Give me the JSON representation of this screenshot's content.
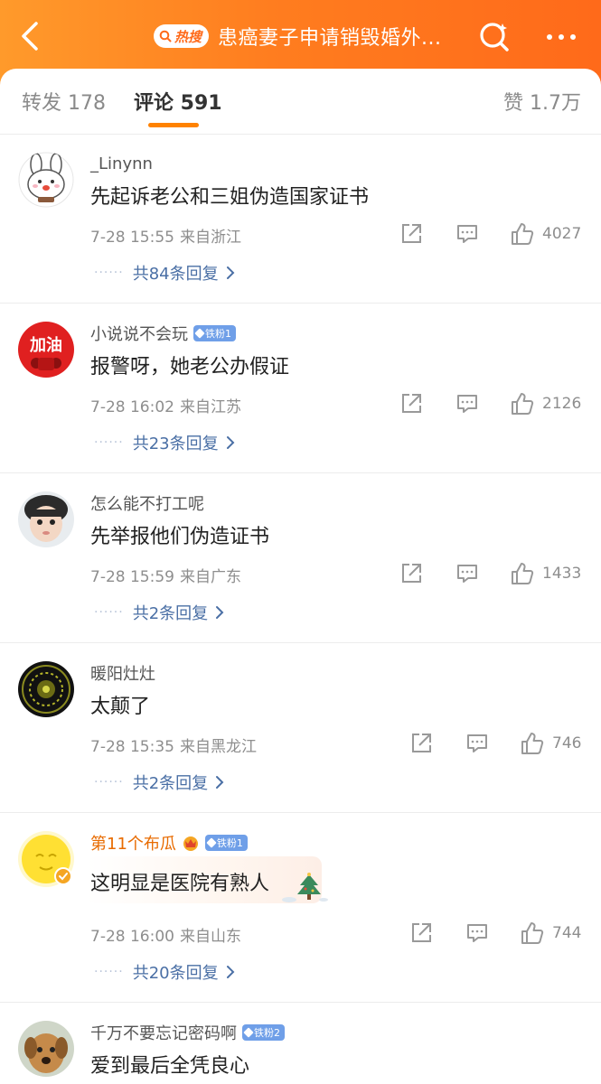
{
  "header": {
    "hot_badge": "热搜",
    "title": "患癌妻子申请销毁婚外...",
    "back_icon": "back-arrow-icon",
    "search_icon": "search-icon",
    "more_icon": "more-icon",
    "gradient_colors": [
      "#ff9a2b",
      "#ff6a1a"
    ]
  },
  "tabs": {
    "repost": "转发 178",
    "comment": "评论 591",
    "like": "赞 1.7万",
    "active": "comment",
    "accent_color": "#ff8200"
  },
  "comments": [
    {
      "username": "_Linynn",
      "badge": "",
      "text": "先起诉老公和三姐伪造国家证书",
      "time": "7-28 15:55",
      "source": "来自浙江",
      "likes": "4027",
      "replies": "共84条回复"
    },
    {
      "username": "小说说不会玩",
      "badge": "铁粉1",
      "text": "报警呀，她老公办假证",
      "time": "7-28 16:02",
      "source": "来自江苏",
      "likes": "2126",
      "replies": "共23条回复"
    },
    {
      "username": "怎么能不打工呢",
      "badge": "",
      "text": "先举报他们伪造证书",
      "time": "7-28 15:59",
      "source": "来自广东",
      "likes": "1433",
      "replies": "共2条回复"
    },
    {
      "username": "暖阳灶灶",
      "badge": "",
      "text": "太颠了",
      "time": "7-28 15:35",
      "source": "来自黑龙江",
      "likes": "746",
      "replies": "共2条回复"
    },
    {
      "username": "第11个布瓜",
      "badge": "铁粉1",
      "text": "这明显是医院有熟人",
      "time": "7-28 16:00",
      "source": "来自山东",
      "likes": "744",
      "replies": "共20条回复"
    },
    {
      "username": "千万不要忘记密码啊",
      "badge": "铁粉2",
      "text": "爱到最后全凭良心"
    }
  ],
  "action_icons": [
    "share-icon",
    "comment-icon",
    "like-icon"
  ],
  "colors": {
    "link": "#4a6fa5",
    "vip_name": "#e86b00",
    "fan_badge": "#6f9fe8"
  }
}
